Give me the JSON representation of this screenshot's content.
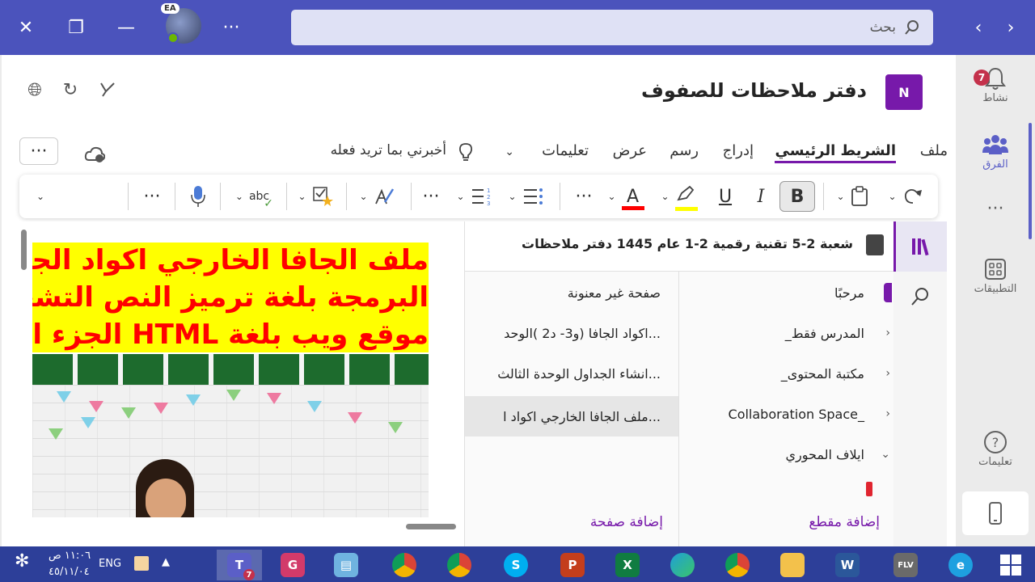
{
  "titlebar": {
    "search_placeholder": "بحث",
    "avatar_initials": "EA",
    "more": "···"
  },
  "rail": {
    "activity_label": "نشاط",
    "activity_badge": "7",
    "teams_label": "الفرق",
    "more": "···",
    "apps_label": "التطبيقات",
    "help_label": "تعليمات"
  },
  "header": {
    "notebook_title": "دفتر ملاحظات للصفوف",
    "app_logo": "N"
  },
  "menu": {
    "file": "ملف",
    "home": "الشريط الرئيسي",
    "insert": "إدراج",
    "draw": "رسم",
    "view": "عرض",
    "help": "تعليمات",
    "tell_me": "أخبرني بما تريد فعله",
    "more": "···"
  },
  "toolbar": {
    "bold": "B",
    "italic": "I",
    "underline": "U",
    "font_color": "A",
    "spelling": "abc",
    "more": "···"
  },
  "page_content": {
    "line1": "ملف الجافا الخارجي اكواد الجافا (",
    "line2": "البرمجة بلغة ترميز النص التشعبي",
    "line3": "موقع ويب بلغة HTML  الجزء الثاني"
  },
  "notebook": {
    "title": "شعبة 2-5 تقنية رقمية 2-1 عام 1445 دفتر ملاحظات",
    "sections": [
      {
        "label": "مرحبًا"
      },
      {
        "label": "_المدرس فقط"
      },
      {
        "label": "_مكتبة المحتوى"
      },
      {
        "label": "Collaboration Space_"
      },
      {
        "label": "ايلاف المحوري"
      }
    ],
    "pages": [
      {
        "label": "صفحة غير معنونة"
      },
      {
        "label": "اكواد الجافا (و3- د2 )الوحد..."
      },
      {
        "label": "انشاء الجداول الوحدة الثالث..."
      },
      {
        "label": "ملف الجافا الخارجي اكواد ا..."
      }
    ],
    "add_section": "إضافة مقطع",
    "add_page": "إضافة صفحة"
  },
  "taskbar": {
    "time": "١١:٠٦ ص",
    "date": "٤٥/١١/٠٤",
    "language": "ENG",
    "teams_badge": "7"
  },
  "colors": {
    "teams_purple": "#4b53bc",
    "onenote_purple": "#7719aa",
    "taskbar": "#2d3f99",
    "highlight_yellow": "#ffff00",
    "text_red": "#ff0000"
  }
}
